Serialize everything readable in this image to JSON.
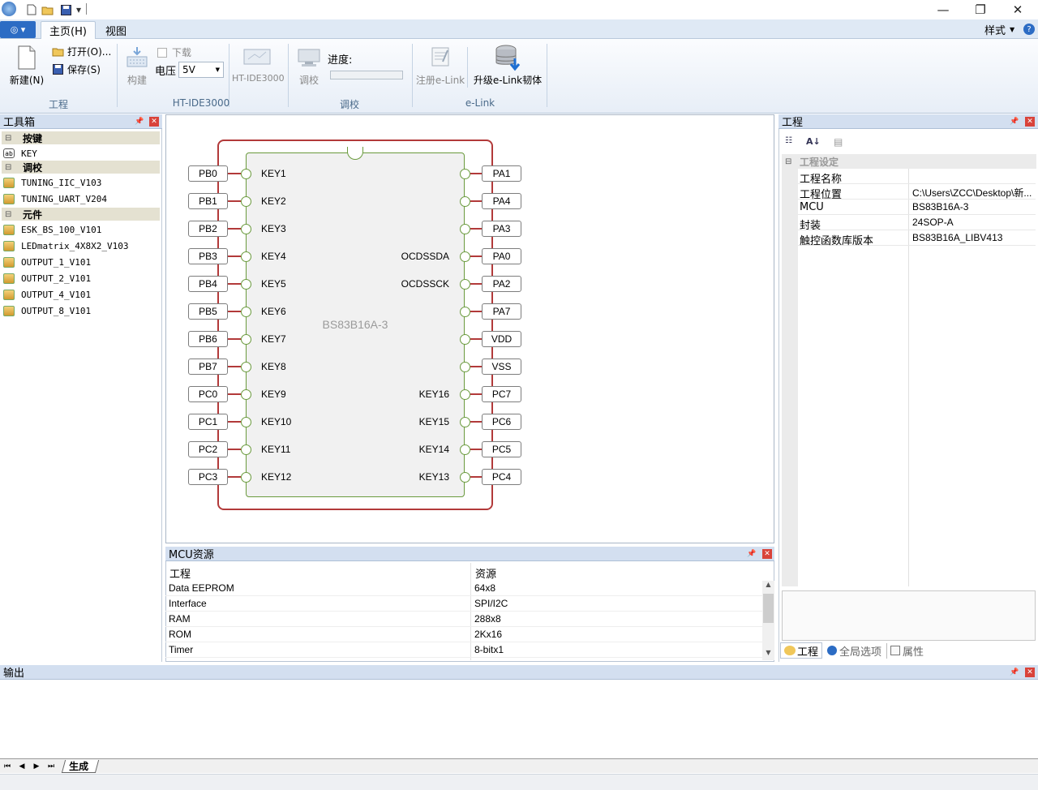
{
  "qa_toolbar": {
    "dropdown_glyph": "▾"
  },
  "window": {
    "minimize": "—",
    "restore": "❐",
    "close": "✕"
  },
  "ribbon_tabs": {
    "app_menu_glyph": "◎ ▾",
    "home": "主页(H)",
    "view": "视图",
    "style_label": "样式",
    "help": "?"
  },
  "ribbon": {
    "project_group": {
      "title": "工程",
      "new_label": "新建(N)",
      "open_label": "打开(O)...",
      "save_label": "保存(S)"
    },
    "ide_group": {
      "title": "HT-IDE3000",
      "build_label": "构建",
      "download_label": "下载",
      "voltage_label": "电压",
      "voltage_value": "5V",
      "ide_label": "HT-IDE3000"
    },
    "tune_group": {
      "title": "调校",
      "tune_label": "调校",
      "progress_label": "进度:",
      "progress": 0
    },
    "elink_group": {
      "title": "e-Link",
      "register_label": "注册e-Link",
      "upgrade_label": "升级e-Link韧体"
    }
  },
  "toolbox": {
    "title": "工具箱",
    "categories": [
      {
        "name": "按键",
        "items": [
          "KEY"
        ]
      },
      {
        "name": "调校",
        "items": [
          "TUNING_IIC_V103",
          "TUNING_UART_V204"
        ]
      },
      {
        "name": "元件",
        "items": [
          "ESK_BS_100_V101",
          "LEDmatrix_4X8X2_V103",
          "OUTPUT_1_V101",
          "OUTPUT_2_V101",
          "OUTPUT_4_V101",
          "OUTPUT_8_V101"
        ]
      }
    ]
  },
  "chip": {
    "name": "BS83B16A-3",
    "left_pins": [
      "PB0",
      "PB1",
      "PB2",
      "PB3",
      "PB4",
      "PB5",
      "PB6",
      "PB7",
      "PC0",
      "PC1",
      "PC2",
      "PC3"
    ],
    "left_inner": [
      "KEY1",
      "KEY2",
      "KEY3",
      "KEY4",
      "KEY5",
      "KEY6",
      "KEY7",
      "KEY8",
      "KEY9",
      "KEY10",
      "KEY11",
      "KEY12"
    ],
    "right_pins": [
      "PA1",
      "PA4",
      "PA3",
      "PA0",
      "PA2",
      "PA7",
      "VDD",
      "VSS",
      "PC7",
      "PC6",
      "PC5",
      "PC4"
    ],
    "right_inner": [
      "",
      "",
      "",
      "OCDSSDA",
      "OCDSSCK",
      "",
      "",
      "",
      "KEY16",
      "KEY15",
      "KEY14",
      "KEY13"
    ]
  },
  "mcu_resources": {
    "title": "MCU资源",
    "columns": [
      "工程",
      "资源"
    ],
    "rows": [
      [
        "Data EEPROM",
        "64x8"
      ],
      [
        "Interface",
        "SPI/I2C"
      ],
      [
        "RAM",
        "288x8"
      ],
      [
        "ROM",
        "2Kx16"
      ],
      [
        "Timer",
        "8-bitx1"
      ]
    ]
  },
  "project_panel": {
    "title": "工程",
    "section": "工程设定",
    "props": [
      [
        "工程名称",
        ""
      ],
      [
        "工程位置",
        "C:\\Users\\ZCC\\Desktop\\新..."
      ],
      [
        "MCU",
        "BS83B16A-3"
      ],
      [
        "封装",
        "24SOP-A"
      ],
      [
        "触控函数库版本",
        "BS83B16A_LIBV413"
      ]
    ],
    "tabs": [
      "工程",
      "全局选项",
      "属性"
    ]
  },
  "output": {
    "title": "输出",
    "tab": "生成"
  },
  "colors": {
    "accent": "#2c6cc4",
    "panel_header": "#d3dff0",
    "chip_outline": "#b23a3a",
    "chip_body": "#6a9a3d"
  }
}
